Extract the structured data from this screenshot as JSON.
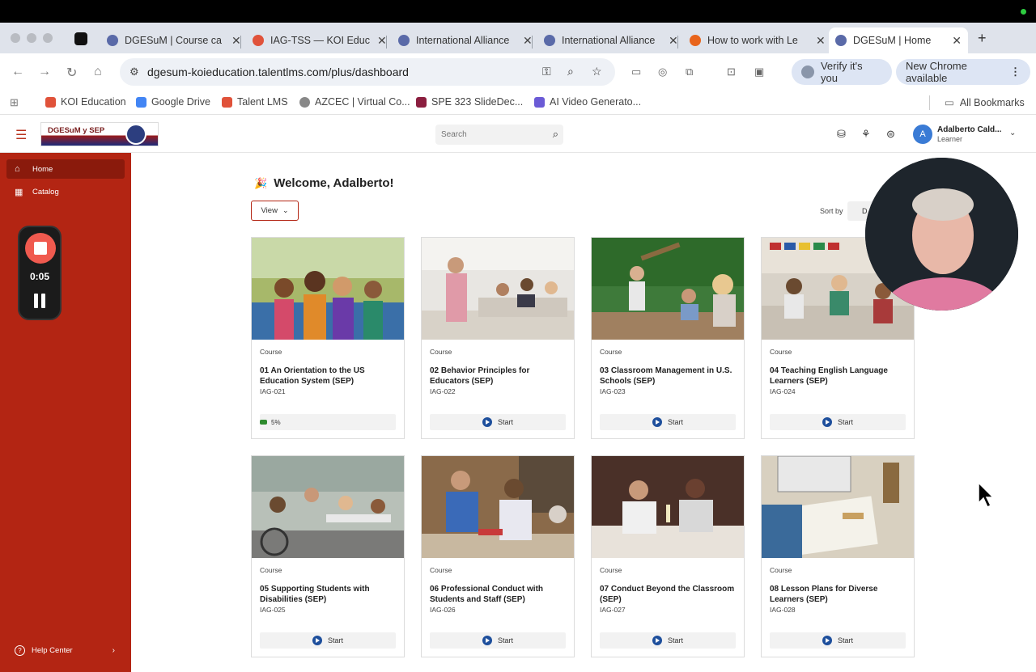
{
  "browser": {
    "tabs": [
      {
        "title": "DGESuM | Course ca",
        "color": "#5a6aa8",
        "active": false
      },
      {
        "title": "IAG-TSS — KOI Educ",
        "color": "#e0523a",
        "active": false
      },
      {
        "title": "International Alliance",
        "color": "#5a6aa8",
        "active": false
      },
      {
        "title": "International Alliance",
        "color": "#5a6aa8",
        "active": false
      },
      {
        "title": "How to work with Le",
        "color": "#e8641b",
        "active": false
      },
      {
        "title": "DGESuM | Home",
        "color": "#5a6aa8",
        "active": true
      }
    ],
    "url": "dgesum-koieducation.talentlms.com/plus/dashboard",
    "verify_label": "Verify it's you",
    "update_label": "New Chrome available",
    "bookmarks": [
      {
        "label": "KOI Education",
        "color": "#e0523a"
      },
      {
        "label": "Google Drive",
        "color": "#4285f4"
      },
      {
        "label": "Talent LMS",
        "color": "#e0523a"
      },
      {
        "label": "AZCEC | Virtual Co...",
        "color": "#888888"
      },
      {
        "label": "SPE 323 SlideDec...",
        "color": "#8b1e3f"
      },
      {
        "label": "AI Video Generato...",
        "color": "#6b5bd6"
      }
    ],
    "all_bookmarks": "All Bookmarks"
  },
  "header": {
    "logo_text": "DGESuM y SEP",
    "search_placeholder": "Search",
    "user_initial": "A",
    "user_name": "Adalberto Cald...",
    "user_role": "Learner"
  },
  "sidebar": {
    "items": [
      {
        "label": "Home",
        "icon": "home-icon",
        "active": true
      },
      {
        "label": "Catalog",
        "icon": "catalog-icon",
        "active": false
      }
    ],
    "help_label": "Help Center"
  },
  "recorder": {
    "time": "0:05"
  },
  "main": {
    "welcome": "Welcome, Adalberto!",
    "view_label": "View",
    "sort_label": "Sort by",
    "sort_value": "D"
  },
  "courses": [
    {
      "type": "Course",
      "title": "01 An Orientation to the US Education System (SEP)",
      "code": "IAG-021",
      "progress": "5%",
      "action": ""
    },
    {
      "type": "Course",
      "title": "02 Behavior Principles for Educators (SEP)",
      "code": "IAG-022",
      "progress": "",
      "action": "Start"
    },
    {
      "type": "Course",
      "title": "03 Classroom Management in U.S. Schools (SEP)",
      "code": "IAG-023",
      "progress": "",
      "action": "Start"
    },
    {
      "type": "Course",
      "title": "04 Teaching English Language Learners (SEP)",
      "code": "IAG-024",
      "progress": "",
      "action": "Start"
    },
    {
      "type": "Course",
      "title": "05 Supporting Students with Disabilities (SEP)",
      "code": "IAG-025",
      "progress": "",
      "action": "Start"
    },
    {
      "type": "Course",
      "title": "06 Professional Conduct with Students and Staff (SEP)",
      "code": "IAG-026",
      "progress": "",
      "action": "Start"
    },
    {
      "type": "Course",
      "title": "07 Conduct Beyond the Classroom (SEP)",
      "code": "IAG-027",
      "progress": "",
      "action": "Start"
    },
    {
      "type": "Course",
      "title": "08 Lesson Plans for Diverse Learners (SEP)",
      "code": "IAG-028",
      "progress": "",
      "action": "Start"
    }
  ]
}
